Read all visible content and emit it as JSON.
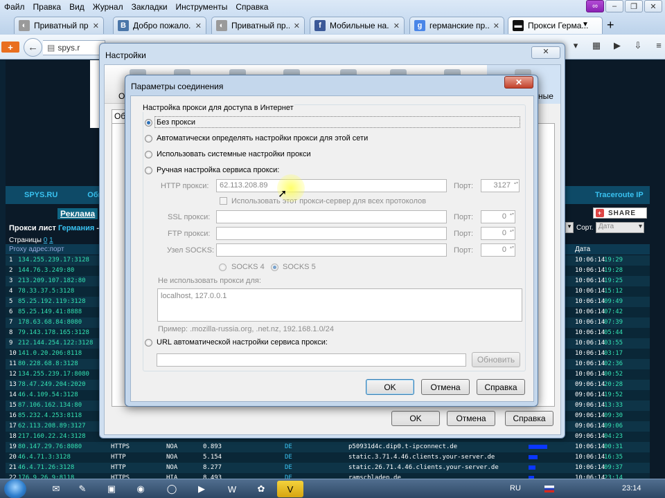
{
  "menubar": [
    "Файл",
    "Правка",
    "Вид",
    "Журнал",
    "Закладки",
    "Инструменты",
    "Справка"
  ],
  "tabs": [
    {
      "title": "Приватный пр...",
      "favicon": "mask-icon",
      "fav_color": "#9a9a9a"
    },
    {
      "title": "Добро пожало...",
      "favicon": "vk-icon",
      "fav_color": "#4a76a8",
      "fav_text": "B"
    },
    {
      "title": "Приватный пр...",
      "favicon": "mask-icon",
      "fav_color": "#9a9a9a"
    },
    {
      "title": "Мобильные на...",
      "favicon": "facebook-icon",
      "fav_color": "#3b5998",
      "fav_text": "f"
    },
    {
      "title": "германские пр...",
      "favicon": "google-icon",
      "fav_color": "#4a86e8",
      "fav_text": "g"
    },
    {
      "title": "Прокси Герма...",
      "favicon": "spys-icon",
      "fav_color": "#111111",
      "active": true
    }
  ],
  "urlbar": {
    "text": "spys.r"
  },
  "spys": {
    "nav": [
      "SPYS.RU",
      "Общи",
      "Traceroute IP"
    ],
    "reklama": "Реклама",
    "share": "SHARE",
    "title_a": "Прокси лист",
    "title_b": "Германия",
    "title_c": "- р",
    "pages_label": "Страницы",
    "pages": [
      "0",
      "1"
    ],
    "sort_label": "Сорт.",
    "sort_value": "Дата",
    "header_ip": "Proxy адрес:порт",
    "header_date": "Дата",
    "rows": [
      {
        "n": "1",
        "ip": "134.255.239.17:3128",
        "d": "10:06:14",
        "t": "19:29"
      },
      {
        "n": "2",
        "ip": "144.76.3.249:80",
        "d": "10:06:14",
        "t": "19:28"
      },
      {
        "n": "3",
        "ip": "213.209.107.182:80",
        "d": "10:06:14",
        "t": "19:25"
      },
      {
        "n": "4",
        "ip": "78.33.37.5:3128",
        "d": "10:06:14",
        "t": "15:12"
      },
      {
        "n": "5",
        "ip": "85.25.192.119:3128",
        "d": "10:06:14",
        "t": "09:49"
      },
      {
        "n": "6",
        "ip": "85.25.149.41:8888",
        "d": "10:06:14",
        "t": "07:42"
      },
      {
        "n": "7",
        "ip": "178.63.68.84:8080",
        "d": "10:06:14",
        "t": "07:39"
      },
      {
        "n": "8",
        "ip": "79.143.178.165:3128",
        "d": "10:06:14",
        "t": "05:44"
      },
      {
        "n": "9",
        "ip": "212.144.254.122:3128",
        "d": "10:06:14",
        "t": "03:55"
      },
      {
        "n": "10",
        "ip": "141.0.20.206:8118",
        "d": "10:06:14",
        "t": "03:17"
      },
      {
        "n": "11",
        "ip": "80.228.68.8:3128",
        "d": "10:06:14",
        "t": "02:36"
      },
      {
        "n": "12",
        "ip": "134.255.239.17:8080",
        "d": "10:06:14",
        "t": "00:52"
      },
      {
        "n": "13",
        "ip": "78.47.249.204:2020",
        "d": "09:06:14",
        "t": "20:28"
      },
      {
        "n": "14",
        "ip": "46.4.109.54:3128",
        "d": "09:06:14",
        "t": "19:52"
      },
      {
        "n": "15",
        "ip": "87.106.162.134:80",
        "d": "09:06:14",
        "t": "13:33"
      },
      {
        "n": "16",
        "ip": "85.232.4.253:8118",
        "d": "09:06:14",
        "t": "09:30"
      },
      {
        "n": "17",
        "ip": "62.113.208.89:3127",
        "d": "09:06:14",
        "t": "09:06"
      },
      {
        "n": "18",
        "ip": "217.160.22.24:3128",
        "d": "09:06:14",
        "t": "04:23"
      },
      {
        "n": "19",
        "ip": "80.147.29.76:8080",
        "typ": "HTTPS",
        "anon": "NOA",
        "spd": "0.893",
        "cc": "DE",
        "host": "p50931d4c.dip0.t-ipconnect.de",
        "bar": 27,
        "d": "10:06:14",
        "t": "00:31"
      },
      {
        "n": "20",
        "ip": "46.4.71.3:3128",
        "typ": "HTTP",
        "anon": "NOA",
        "spd": "5.154",
        "cc": "DE",
        "host": "static.3.71.4.46.clients.your-server.de",
        "bar": 13,
        "d": "10:06:14",
        "t": "16:35"
      },
      {
        "n": "21",
        "ip": "46.4.71.26:3128",
        "typ": "HTTP",
        "anon": "NOA",
        "spd": "8.277",
        "cc": "DE",
        "host": "static.26.71.4.46.clients.your-server.de",
        "bar": 10,
        "d": "10:06:14",
        "t": "09:37"
      },
      {
        "n": "22",
        "ip": "176.9.26.9:8118",
        "typ": "HTTPS",
        "anon": "HIA",
        "spd": "8.493",
        "cc": "DE",
        "host": "ramschladen.de",
        "bar": 8,
        "d": "10:06:14",
        "t": "23:14"
      }
    ]
  },
  "settings": {
    "title": "Настройки",
    "close": "✕",
    "subtab": "Оби",
    "ok": "OK",
    "cancel": "Отмена",
    "help": "Справка",
    "cut_label_left": "О",
    "cut_label_right": "ные"
  },
  "dialog": {
    "title": "Параметры соединения",
    "close": "✕",
    "group_title": "Настройка прокси для доступа в Интернет",
    "opt_none": "Без прокси",
    "opt_auto": "Автоматически определять настройки прокси для этой сети",
    "opt_system": "Использовать системные настройки прокси",
    "opt_manual": "Ручная настройка сервиса прокси:",
    "http_label": "HTTP прокси:",
    "http_value": "62.113.208.89",
    "port_label": "Порт:",
    "http_port": "3127",
    "use_all": "Использовать этот прокси-сервер для всех протоколов",
    "ssl_label": "SSL прокси:",
    "ftp_label": "FTP прокси:",
    "socks_label": "Узел SOCKS:",
    "port_zero": "0",
    "socks4": "SOCKS 4",
    "socks5": "SOCKS 5",
    "no_proxy_label": "Не использовать прокси для:",
    "no_proxy_value": "localhost, 127.0.0.1",
    "example": "Пример: .mozilla-russia.org, .net.nz, 192.168.1.0/24",
    "opt_pac": "URL автоматической настройки сервиса прокси:",
    "reload": "Обновить",
    "ok": "OK",
    "cancel": "Отмена",
    "help": "Справка"
  },
  "taskbar": {
    "lang": "RU",
    "time": "23:14"
  }
}
